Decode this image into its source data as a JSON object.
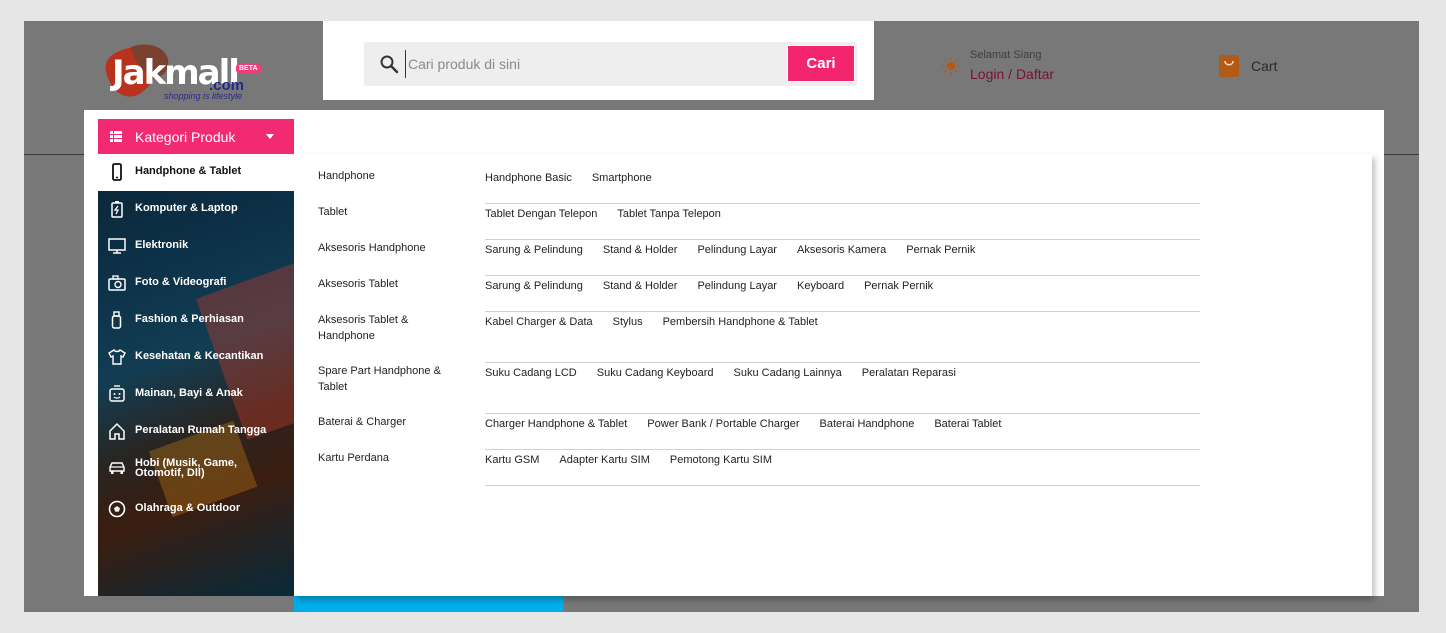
{
  "logo": {
    "brand": "Jakmall",
    "domain": ".com",
    "badge": "BETA",
    "tagline": "shopping is lifestyle"
  },
  "search": {
    "placeholder": "Cari produk di sini",
    "value": "",
    "button_label": "Cari"
  },
  "greeting": {
    "text": "Selamat Siang",
    "login": "Login",
    "separator": " / ",
    "register": "Daftar"
  },
  "cart": {
    "label": "Cart"
  },
  "kategori": {
    "label": "Kategori Produk"
  },
  "sidebar": {
    "items": [
      {
        "label": "Handphone & Tablet",
        "icon": "phone-icon",
        "active": true
      },
      {
        "label": "Komputer & Laptop",
        "icon": "battery-icon"
      },
      {
        "label": "Elektronik",
        "icon": "monitor-icon"
      },
      {
        "label": "Foto & Videografi",
        "icon": "camera-icon"
      },
      {
        "label": "Fashion & Perhiasan",
        "icon": "bottle-icon"
      },
      {
        "label": "Kesehatan & Kecantikan",
        "icon": "shirt-icon"
      },
      {
        "label": "Mainan, Bayi & Anak",
        "icon": "toy-icon"
      },
      {
        "label": "Peralatan Rumah Tangga",
        "icon": "home-icon"
      },
      {
        "label": "Hobi (Musik, Game, Otomotif, Dll)",
        "icon": "car-icon"
      },
      {
        "label": "Olahraga & Outdoor",
        "icon": "ball-icon"
      }
    ]
  },
  "submenu": {
    "rows": [
      {
        "category": "Handphone",
        "items": [
          "Handphone Basic",
          "Smartphone"
        ]
      },
      {
        "category": "Tablet",
        "items": [
          "Tablet Dengan Telepon",
          "Tablet Tanpa Telepon"
        ]
      },
      {
        "category": "Aksesoris Handphone",
        "items": [
          "Sarung & Pelindung",
          "Stand & Holder",
          "Pelindung Layar",
          "Aksesoris Kamera",
          "Pernak Pernik"
        ]
      },
      {
        "category": "Aksesoris Tablet",
        "items": [
          "Sarung & Pelindung",
          "Stand & Holder",
          "Pelindung Layar",
          "Keyboard",
          "Pernak Pernik"
        ]
      },
      {
        "category": "Aksesoris Tablet & Handphone",
        "items": [
          "Kabel Charger & Data",
          "Stylus",
          "Pembersih Handphone & Tablet"
        ]
      },
      {
        "category": "Spare Part Handphone & Tablet",
        "items": [
          "Suku Cadang LCD",
          "Suku Cadang Keyboard",
          "Suku Cadang Lainnya",
          "Peralatan Reparasi"
        ]
      },
      {
        "category": "Baterai & Charger",
        "items": [
          "Charger Handphone & Tablet",
          "Power Bank / Portable Charger",
          "Baterai Handphone",
          "Baterai Tablet"
        ]
      },
      {
        "category": "Kartu Perdana",
        "items": [
          "Kartu GSM",
          "Adapter Kartu SIM",
          "Pemotong Kartu SIM"
        ]
      }
    ]
  },
  "colors": {
    "accent": "#f2256e",
    "sidebar_bg": "#0c3148",
    "overlay": "#787878",
    "blue_tab": "#00adea"
  }
}
